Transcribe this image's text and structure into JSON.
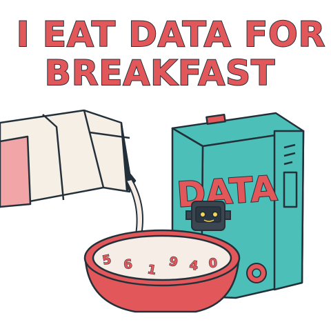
{
  "headline": {
    "line1": "I EAT DATA FOR",
    "line2": "BREAKFAST"
  },
  "cereal_box": {
    "word": "DATA"
  },
  "bowl": {
    "digits": [
      "5",
      "6",
      "1",
      "9",
      "4",
      "0"
    ]
  },
  "colors": {
    "text_red": "#e2585a",
    "outline": "#23303a",
    "box_teal": "#4bbfb8",
    "box_flap_yellow": "#d6c34f",
    "carton_cream": "#f6efe6",
    "carton_pink": "#f2a5a6",
    "bowl_red": "#e2585a",
    "milk": "#f5ede6"
  }
}
